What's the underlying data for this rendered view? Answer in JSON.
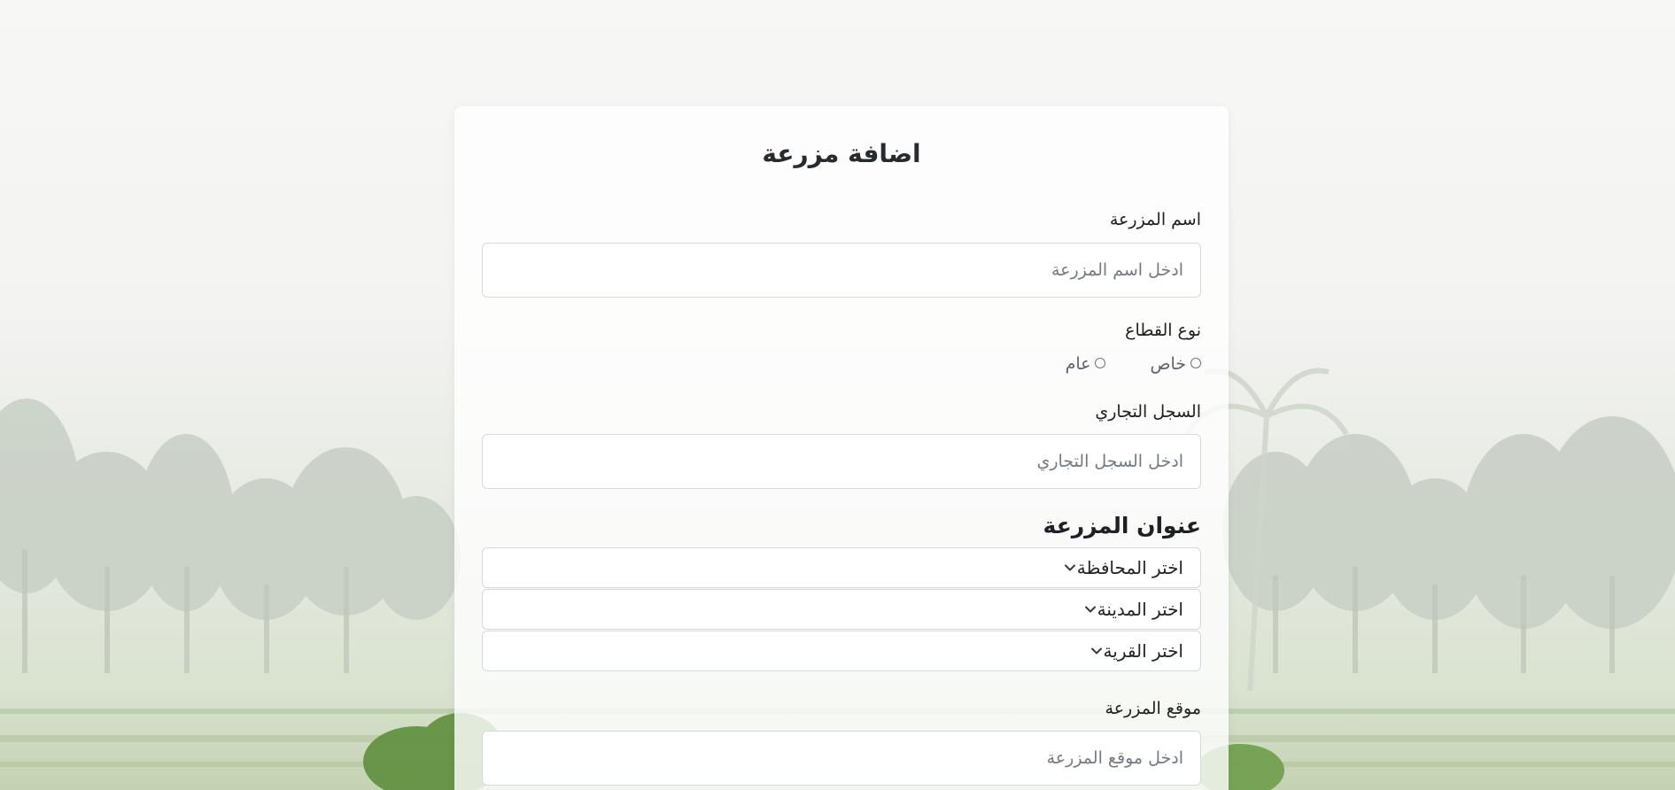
{
  "form": {
    "title": "اضافة مزرعة",
    "farm_name": {
      "label": "اسم المزرعة",
      "placeholder": "ادخل اسم المزرعة",
      "value": ""
    },
    "sector": {
      "label": "نوع القطاع",
      "options": [
        "خاص",
        "عام"
      ],
      "selected": null
    },
    "commercial_register": {
      "label": "السجل التجاري",
      "placeholder": "ادخل السجل التجاري",
      "value": ""
    },
    "address": {
      "title": "عنوان المزرعة",
      "governorate": "اختر المحافظة",
      "city": "اختر المدينة",
      "village": "اختر القرية"
    },
    "farm_location": {
      "label": "موقع المزرعة",
      "placeholder": "ادخل موقع المزرعة",
      "value": ""
    }
  },
  "icons": {
    "dropdown": "chevron-down-icon",
    "radio": "radio-unchecked-icon"
  },
  "colors": {
    "card_bg": "#ffffff",
    "text": "#212529",
    "border": "#d6d9dc",
    "placeholder": "#727b84"
  }
}
